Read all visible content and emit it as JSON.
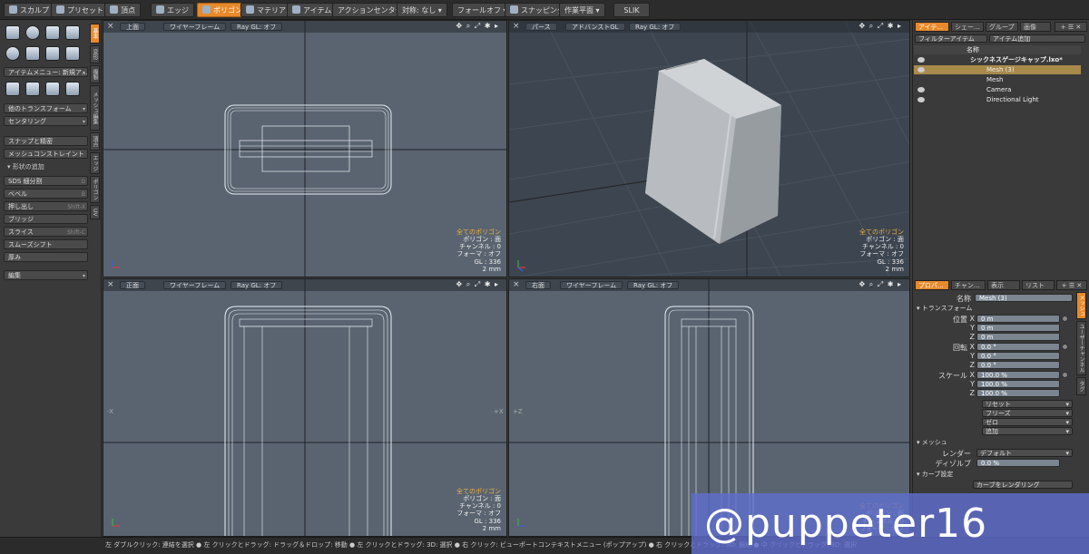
{
  "toolbar": {
    "sculpt": "スカルプト",
    "preset": "プリセット",
    "vertex": "頂点",
    "edge": "エッジ",
    "polygon": "ポリゴン",
    "material": "マテリアル",
    "item": "アイテム",
    "action_center": "アクションセンター",
    "symmetry": "対称: なし",
    "falloff": "フォールオフ",
    "snapping": "スナッピング",
    "work_plane": "作業平面",
    "slik": "SLIK"
  },
  "left": {
    "item_menu": "アイテムメニュー: 新規ア...",
    "other_transform": "他のトランスフォーム",
    "centering": "センタリング",
    "snap_precise": "スナップと精密",
    "mesh_constraint": "メッシュコンストレイント",
    "add_shape": "形状の追加",
    "tools": [
      {
        "label": "SDS 細分割",
        "shortcut": "D"
      },
      {
        "label": "ベベル",
        "shortcut": "B"
      },
      {
        "label": "押し出し",
        "shortcut": "Shift-X"
      },
      {
        "label": "ブリッジ",
        "shortcut": ""
      },
      {
        "label": "スライス",
        "shortcut": "Shift-C"
      },
      {
        "label": "スムーズシフト",
        "shortcut": ""
      },
      {
        "label": "厚み",
        "shortcut": ""
      }
    ],
    "edit": "編集",
    "vtabs": [
      "基本",
      "変形",
      "複製",
      "メッシュ編集",
      "頂点",
      "エッジ",
      "ポリゴン",
      "UV"
    ]
  },
  "viewports": {
    "top": {
      "view": "上面",
      "shading": "ワイヤーフレーム",
      "raygl": "Ray GL: オフ"
    },
    "persp": {
      "view": "パース",
      "shading": "アドバンストGL",
      "raygl": "Ray GL: オフ"
    },
    "front": {
      "view": "正面",
      "shading": "ワイヤーフレーム",
      "raygl": "Ray GL: オフ"
    },
    "right": {
      "view": "右面",
      "shading": "ワイヤーフレーム",
      "raygl": "Ray GL: オフ"
    },
    "icons": "✥ ⌕ ⤢ ✱ ▸",
    "stats": {
      "all_polygons": "全てのポリゴン",
      "polygon": "ポリゴン : 面",
      "channel": "チャンネル : 0",
      "format": "フォーマ : オフ",
      "gl": "GL : 336",
      "unit": "2 mm"
    }
  },
  "right": {
    "tabs_top": [
      "アイテ...",
      "シェー...",
      "グループ",
      "画像"
    ],
    "filter": "フィルターアイテム",
    "add_item": "アイテム追加",
    "name_header": "名称",
    "tree": [
      {
        "label": "シックネスゲージキャップ.lxo*",
        "selected": false
      },
      {
        "label": "Mesh (3)",
        "selected": true
      },
      {
        "label": "Mesh",
        "selected": false
      },
      {
        "label": "Camera",
        "selected": false
      },
      {
        "label": "Directional Light",
        "selected": false
      }
    ],
    "tabs_bottom": [
      "プロパ...",
      "チャン...",
      "表示",
      "リスト"
    ],
    "vtabs": [
      "メッシュ",
      "ユーザーチャンネル",
      "タグ"
    ],
    "props": {
      "name_label": "名称",
      "name_value": "Mesh (3)",
      "transform": "トランスフォーム",
      "position": "位置",
      "rotation": "回転",
      "scale": "スケール",
      "axes": [
        "X",
        "Y",
        "Z"
      ],
      "pos_values": [
        "0 m",
        "0 m",
        "0 m"
      ],
      "rot_values": [
        "0.0 °",
        "0.0 °",
        "0.0 °"
      ],
      "scale_values": [
        "100.0 %",
        "100.0 %",
        "100.0 %"
      ],
      "reset": "リセット",
      "freeze": "フリーズ",
      "zero": "ゼロ",
      "add": "追加",
      "mesh": "メッシュ",
      "render_label": "レンダー",
      "render_value": "デフォルト",
      "dissolve_label": "ディゾルブ",
      "dissolve_value": "0.0 %",
      "curve_settings": "カーブ設定",
      "render_curves": "カーブをレンダリング"
    }
  },
  "status": "左 ダブルクリック: 連結を選択 ● 左 クリックとドラッグ: ドラッグ＆ドロップ: 移動 ● 左 クリックとドラッグ: 3D: 選択 ● 右 クリック: ビューポートコンテキストメニュー (ポップアップ) ● 右 クリックとドラッグ: 3D: 鏡縁 ● 中 クリックとドラッグ: 3D: 選択",
  "watermark": "@puppeter16"
}
